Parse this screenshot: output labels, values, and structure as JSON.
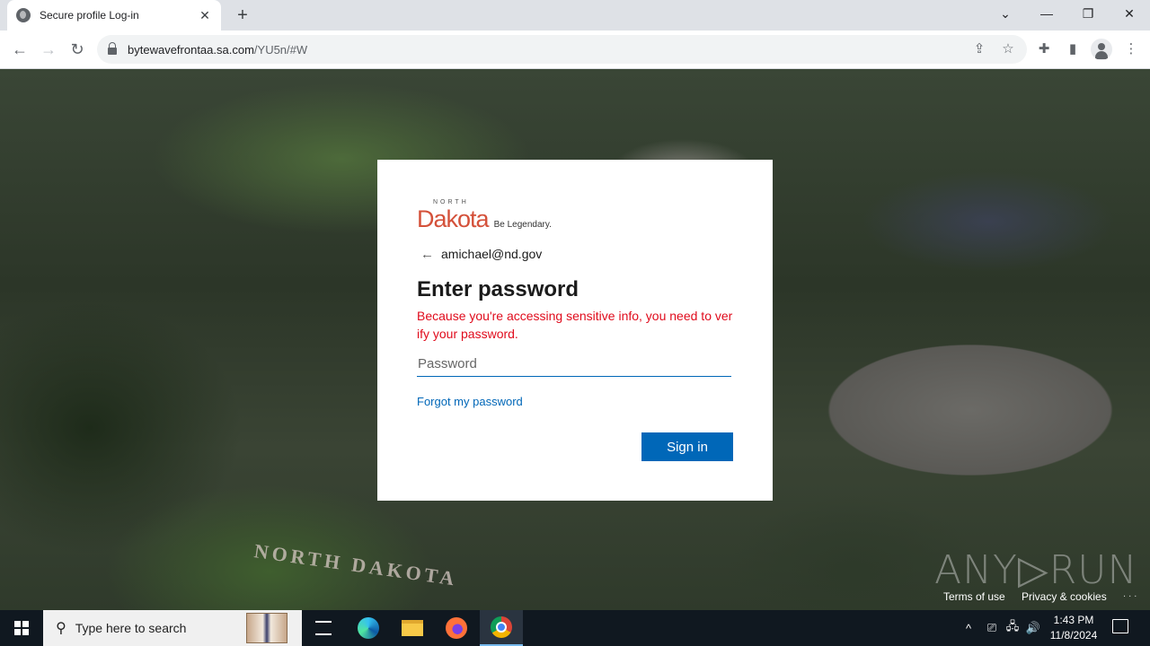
{
  "browser": {
    "tab": {
      "title": "Secure profile Log-in",
      "icon": "globe-icon",
      "close_glyph": "✕"
    },
    "new_tab_glyph": "+",
    "window_controls": {
      "tab_search": "⌄",
      "minimize": "—",
      "restore": "❐",
      "close": "✕"
    },
    "nav": {
      "back": "←",
      "forward": "→",
      "reload": "↻"
    },
    "url": {
      "host": "bytewavefrontaa.sa.com",
      "path": "/YU5n/#W"
    },
    "toolbar_icons": {
      "share": "⇪",
      "bookmark": "☆",
      "extensions": "✚",
      "side_panel": "▮",
      "menu": "⋮"
    }
  },
  "login": {
    "logo": {
      "north": "NORTH",
      "dakota": "Dakota",
      "tagline": "Be Legendary."
    },
    "back_arrow": "←",
    "email": "amichael@nd.gov",
    "heading": "Enter password",
    "error": "Because you're accessing sensitive info, you need to verify your password.",
    "password_placeholder": "Password",
    "password_value": "",
    "forgot_link": "Forgot my password",
    "signin_label": "Sign in",
    "colors": {
      "accent": "#0067b8",
      "error": "#e00b1c",
      "logo": "#d4513a"
    }
  },
  "background": {
    "sign_text": "NORTH DAKOTA"
  },
  "footer": {
    "watermark": "ANY▷RUN",
    "terms": "Terms of use",
    "privacy": "Privacy & cookies",
    "more": ". . ."
  },
  "taskbar": {
    "search_placeholder": "Type here to search",
    "apps": [
      "task-view",
      "edge",
      "file-explorer",
      "firefox",
      "chrome"
    ],
    "tray": {
      "chevron": "^",
      "meet": "⎚",
      "network": "🖧",
      "volume": "🔊"
    },
    "time": "1:43 PM",
    "date": "11/8/2024"
  }
}
